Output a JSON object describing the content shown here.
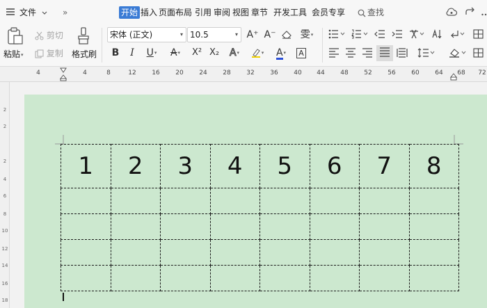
{
  "menu": {
    "file_label": "文件",
    "more": "»",
    "tabs": [
      {
        "label": "开始",
        "active": true
      },
      {
        "label": "插入",
        "active": false
      },
      {
        "label": "页面布局",
        "active": false
      },
      {
        "label": "引用",
        "active": false
      },
      {
        "label": "审阅",
        "active": false
      },
      {
        "label": "视图",
        "active": false
      },
      {
        "label": "章节",
        "active": false
      },
      {
        "label": "开发工具",
        "active": false
      },
      {
        "label": "会员专享",
        "active": false
      }
    ],
    "search_label": "查找"
  },
  "ribbon": {
    "paste_label": "粘贴",
    "cut_label": "剪切",
    "copy_label": "复制",
    "format_painter_label": "格式刷",
    "font_name": "宋体 (正文)",
    "font_size": "10.5",
    "bold": "B",
    "italic": "I",
    "underline": "U",
    "strikethrough": "A",
    "superscript": "X²",
    "subscript": "X₂",
    "text_effect": "A",
    "font_color": "A",
    "char_border": "A",
    "grow_font": "A⁺",
    "shrink_font": "A⁻",
    "phonetic": "雯"
  },
  "ruler": {
    "marks": [
      "4",
      "4",
      "8",
      "12",
      "16",
      "20",
      "24",
      "28",
      "32",
      "36",
      "40",
      "44",
      "48",
      "52",
      "56",
      "60",
      "64",
      "68",
      "72"
    ],
    "vertical_marks": [
      "2",
      "2",
      "2",
      "4",
      "6",
      "8",
      "10",
      "12",
      "14",
      "16",
      "18"
    ]
  },
  "table": {
    "header": [
      "1",
      "2",
      "3",
      "4",
      "5",
      "6",
      "7",
      "8"
    ],
    "empty_rows": 4
  },
  "colors": {
    "page_background": "#cce8cf",
    "active_tab": "#3a7bd5",
    "workspace": "#f2f2f2"
  }
}
